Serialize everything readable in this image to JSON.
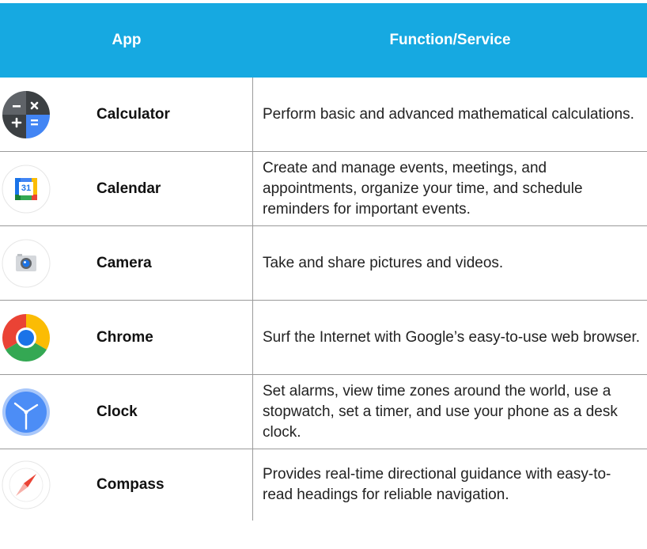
{
  "table": {
    "headers": {
      "app": "App",
      "function": "Function/Service"
    },
    "rows": [
      {
        "name": "Calculator",
        "icon": "calculator-icon",
        "description": "Perform basic and advanced mathematical calculations."
      },
      {
        "name": "Calendar",
        "icon": "calendar-icon",
        "icon_text": "31",
        "description": "Create and manage events, meetings, and appointments, organize your time, and schedule reminders for important events."
      },
      {
        "name": "Camera",
        "icon": "camera-icon",
        "description": "Take and share pictures and videos."
      },
      {
        "name": "Chrome",
        "icon": "chrome-icon",
        "description": "Surf the Internet with Google’s easy-to-use web browser."
      },
      {
        "name": "Clock",
        "icon": "clock-icon",
        "description": "Set alarms, view time zones around the world, use a stopwatch, set a timer, and use your phone as a desk clock."
      },
      {
        "name": "Compass",
        "icon": "compass-icon",
        "description": "Provides real-time directional guidance with easy-to-read headings for reliable navigation."
      }
    ]
  },
  "colors": {
    "header_bg": "#16a9e1",
    "header_text": "#ffffff",
    "border": "#9a9a9a"
  }
}
